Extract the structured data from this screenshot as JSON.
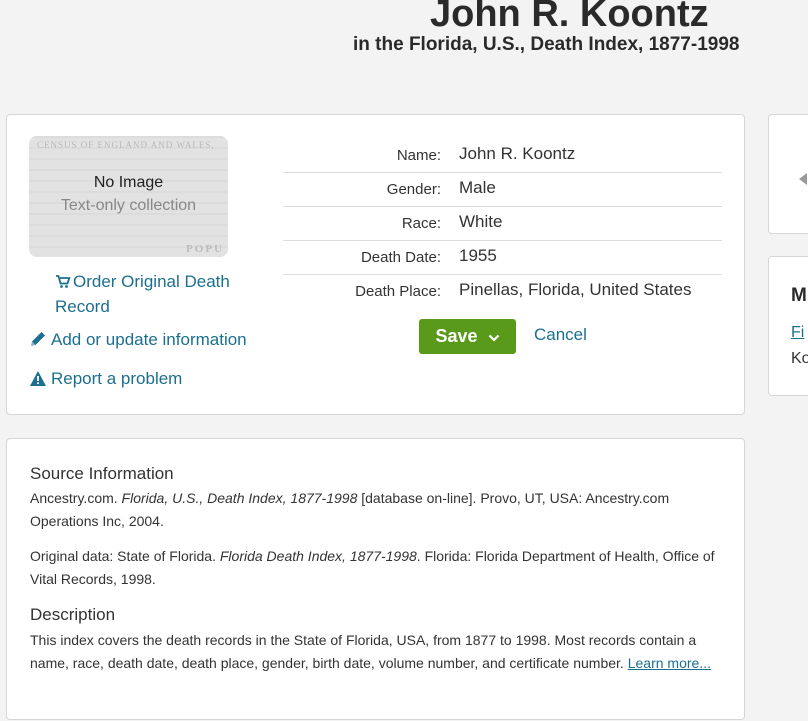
{
  "header": {
    "title": "John R. Koontz",
    "subtitle": "in the Florida, U.S., Death Index, 1877-1998"
  },
  "image_panel": {
    "no_image": "No Image",
    "text_only": "Text-only collection",
    "bg_text": "CENSUS OF ENGLAND AND WALES,",
    "bg_bottom": "POPU",
    "order_link": "Order Original Death Record",
    "add_link": "Add or update information",
    "report_link": "Report a problem"
  },
  "facts": [
    {
      "label": "Name:",
      "value": "John R. Koontz"
    },
    {
      "label": "Gender:",
      "value": "Male"
    },
    {
      "label": "Race:",
      "value": "White"
    },
    {
      "label": "Death Date:",
      "value": "1955"
    },
    {
      "label": "Death Place:",
      "value": "Pinellas, Florida, United States"
    }
  ],
  "actions": {
    "save": "Save",
    "cancel": "Cancel"
  },
  "source": {
    "heading": "Source Information",
    "line1_pre": "Ancestry.com. ",
    "line1_ital": "Florida, U.S., Death Index, 1877-1998",
    "line1_post": " [database on-line]. Provo, UT, USA: Ancestry.com Operations Inc, 2004.",
    "line2_pre": "Original data: State of Florida. ",
    "line2_ital": "Florida Death Index, 1877-1998",
    "line2_post": ". Florida: Florida Department of Health, Office of Vital Records, 1998.",
    "desc_heading": "Description",
    "desc_text": "This index covers the death records in the State of Florida, USA, from 1877 to 1998. Most records contain a name, race, death date, death place, gender, birth date, volume number, and certificate number. ",
    "learn_more": "Learn more..."
  },
  "side": {
    "heading_fragment": "M",
    "link_fragment": "Fi",
    "text_fragment": "Ko"
  },
  "colors": {
    "link": "#1c6f8d",
    "save_button": "#5a9a1a",
    "background": "#f3f3f3"
  }
}
